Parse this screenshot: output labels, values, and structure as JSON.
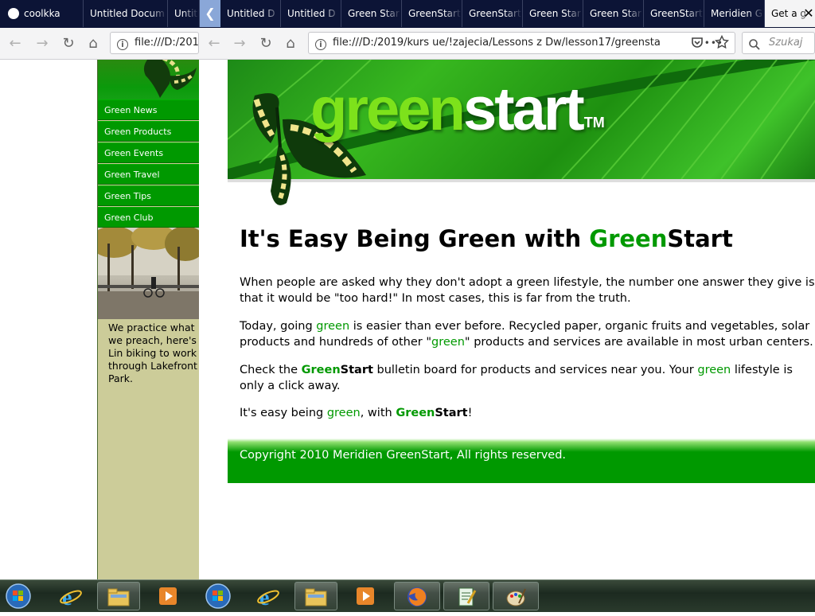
{
  "tabs": [
    {
      "label": "coolkka",
      "icon": "github-icon"
    },
    {
      "label": "Untitled Docum"
    },
    {
      "label": "Untitl"
    },
    {
      "label": "Untitled D"
    },
    {
      "label": "Untitled D"
    },
    {
      "label": "Green Star"
    },
    {
      "label": "GreenStart"
    },
    {
      "label": "GreenStart"
    },
    {
      "label": "Green Star"
    },
    {
      "label": "Green Star"
    },
    {
      "label": "GreenStart"
    },
    {
      "label": "Meridien G"
    },
    {
      "label": "Get a g",
      "active": true
    }
  ],
  "toolbar": {
    "back": "←",
    "forward": "→",
    "reload": "↻",
    "home": "⌂",
    "left_url": "file:///D:/201",
    "url": "file:///D:/2019/kurs ue/!zajecia/Lessons z Dw/lesson17/greensta",
    "more": "•••",
    "search_placeholder": "Szukaj",
    "info": "i",
    "tab_close": "✕",
    "tab_scroll": "❮"
  },
  "sidebar": {
    "nav": [
      "Green News",
      "Green Products",
      "Green Events",
      "Green Travel",
      "Green Tips",
      "Green Club"
    ],
    "caption": "We practice what we preach, here's Lin biking to work through Lakefront Park."
  },
  "logo": {
    "part1": "green",
    "part2": "start",
    "tm": "TM"
  },
  "main": {
    "heading_pre": "It's Easy Being Green with ",
    "heading_green": "Green",
    "heading_start": "Start",
    "p1": "When people are asked why they don't adopt a green lifestyle, the number one answer they give is that it would be \"too hard!\" In most cases, this is far from the truth.",
    "p2_a": "Today, going ",
    "p2_green": "green",
    "p2_b": " is easier than ever before. Recycled paper, organic fruits and vegetables, solar products and hundreds of other \"",
    "p2_green2": "green",
    "p2_c": "\" products and services are available in most urban centers.",
    "p3_a": "Check the ",
    "p3_brand_green": "Green",
    "p3_brand_start": "Start",
    "p3_b": " bulletin board for products and services near you. Your ",
    "p3_green": "green",
    "p3_c": " lifestyle is only a click away.",
    "p4_a": "It's easy being ",
    "p4_green": "green",
    "p4_b": ", with ",
    "p4_brand_green": "Green",
    "p4_brand_start": "Start",
    "p4_c": "!"
  },
  "footer": {
    "copyright": "Copyright 2010 Meridien GreenStart, All rights reserved."
  },
  "colors": {
    "brand_green": "#009900",
    "sidebar_tan": "#cccc99",
    "logo_green": "#7de21b"
  },
  "taskbar": {
    "icons": [
      "windows-start-icon",
      "ie-icon",
      "explorer-icon",
      "media-player-icon",
      "windows-start-icon",
      "ie-icon",
      "explorer-icon",
      "media-player-icon",
      "firefox-icon",
      "notepad-icon",
      "paint-icon"
    ]
  }
}
